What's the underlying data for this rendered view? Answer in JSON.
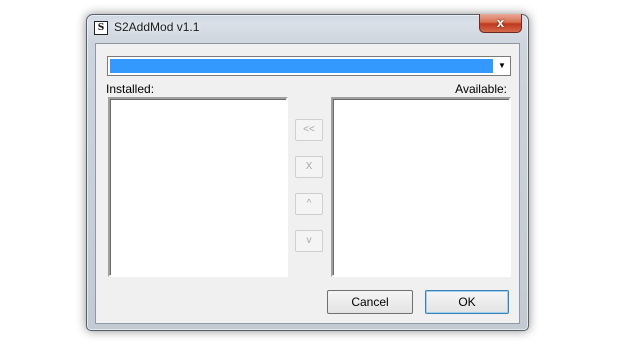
{
  "window": {
    "title": "S2AddMod v1.1",
    "icon": "s2-app-icon",
    "close_glyph": "x"
  },
  "combo": {
    "selected_text": "",
    "arrow_glyph": "▼"
  },
  "labels": {
    "installed": "Installed:",
    "available": "Available:"
  },
  "lists": {
    "installed_items": [],
    "available_items": []
  },
  "side_buttons": {
    "move_left": "<<",
    "remove": "X",
    "move_up": "^",
    "move_down": "v"
  },
  "buttons": {
    "cancel": "Cancel",
    "ok": "OK"
  },
  "colors": {
    "selection": "#3399ff",
    "close": "#c0381e"
  }
}
